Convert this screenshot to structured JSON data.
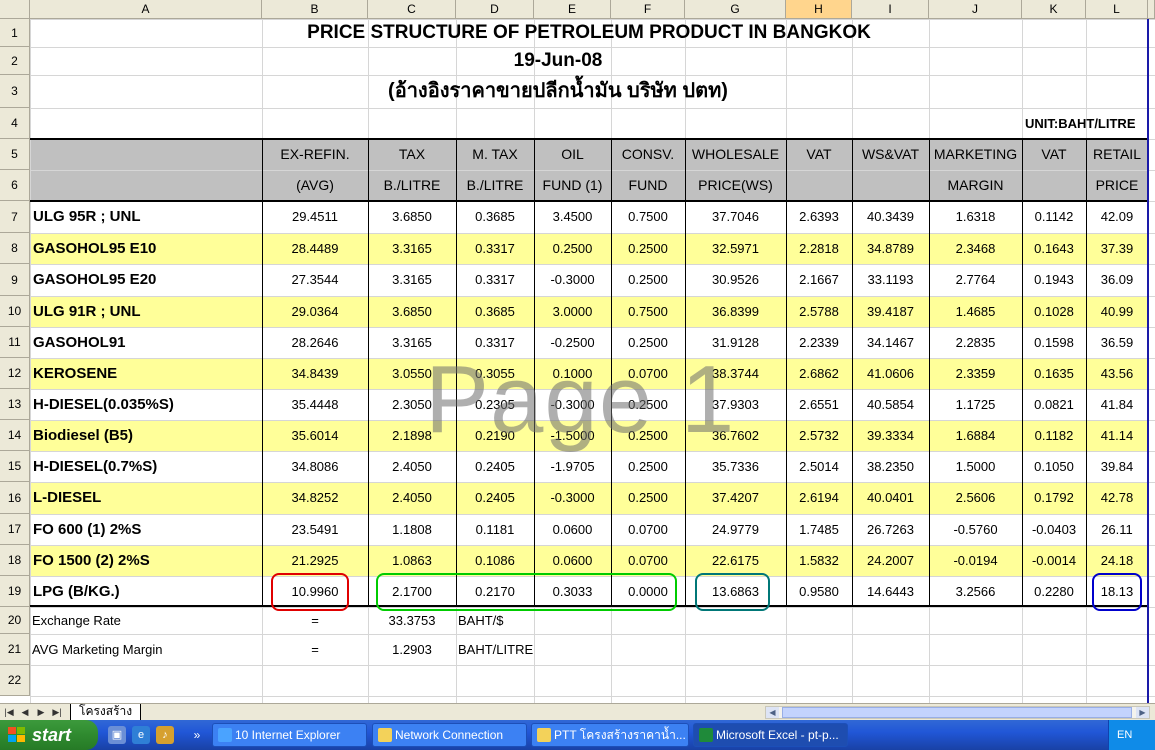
{
  "columns": [
    "A",
    "B",
    "C",
    "D",
    "E",
    "F",
    "G",
    "H",
    "I",
    "J",
    "K",
    "L"
  ],
  "rows": [
    "1",
    "2",
    "3",
    "4",
    "5",
    "6",
    "7",
    "8",
    "9",
    "10",
    "11",
    "12",
    "13",
    "14",
    "15",
    "16",
    "17",
    "18",
    "19",
    "20",
    "21",
    "22"
  ],
  "title": "PRICE STRUCTURE OF PETROLEUM PRODUCT IN BANGKOK",
  "date": "19-Jun-08",
  "reference": "(อ้างอิงราคาขายปลีกน้ำมัน บริษัท ปตท)",
  "unit": "UNIT:BAHT/LITRE",
  "headers": [
    [
      "EX-REFIN.",
      "(AVG)"
    ],
    [
      "TAX",
      "B./LITRE"
    ],
    [
      "M. TAX",
      "B./LITRE"
    ],
    [
      "OIL",
      "FUND (1)"
    ],
    [
      "CONSV.",
      "FUND"
    ],
    [
      "WHOLESALE",
      "PRICE(WS)"
    ],
    [
      "VAT",
      ""
    ],
    [
      "WS&VAT",
      ""
    ],
    [
      "MARKETING",
      "MARGIN"
    ],
    [
      "VAT",
      ""
    ],
    [
      "RETAIL",
      "PRICE"
    ]
  ],
  "products": [
    {
      "name": "ULG 95R ; UNL",
      "values": [
        "29.4511",
        "3.6850",
        "0.3685",
        "3.4500",
        "0.7500",
        "37.7046",
        "2.6393",
        "40.3439",
        "1.6318",
        "0.1142",
        "42.09"
      ]
    },
    {
      "name": "GASOHOL95 E10",
      "values": [
        "28.4489",
        "3.3165",
        "0.3317",
        "0.2500",
        "0.2500",
        "32.5971",
        "2.2818",
        "34.8789",
        "2.3468",
        "0.1643",
        "37.39"
      ]
    },
    {
      "name": "GASOHOL95 E20",
      "values": [
        "27.3544",
        "3.3165",
        "0.3317",
        "-0.3000",
        "0.2500",
        "30.9526",
        "2.1667",
        "33.1193",
        "2.7764",
        "0.1943",
        "36.09"
      ]
    },
    {
      "name": "ULG 91R ; UNL",
      "values": [
        "29.0364",
        "3.6850",
        "0.3685",
        "3.0000",
        "0.7500",
        "36.8399",
        "2.5788",
        "39.4187",
        "1.4685",
        "0.1028",
        "40.99"
      ]
    },
    {
      "name": "GASOHOL91",
      "values": [
        "28.2646",
        "3.3165",
        "0.3317",
        "-0.2500",
        "0.2500",
        "31.9128",
        "2.2339",
        "34.1467",
        "2.2835",
        "0.1598",
        "36.59"
      ]
    },
    {
      "name": "KEROSENE",
      "values": [
        "34.8439",
        "3.0550",
        "0.3055",
        "0.1000",
        "0.0700",
        "38.3744",
        "2.6862",
        "41.0606",
        "2.3359",
        "0.1635",
        "43.56"
      ]
    },
    {
      "name": "H-DIESEL(0.035%S)",
      "values": [
        "35.4448",
        "2.3050",
        "0.2305",
        "-0.3000",
        "0.2500",
        "37.9303",
        "2.6551",
        "40.5854",
        "1.1725",
        "0.0821",
        "41.84"
      ]
    },
    {
      "name": "Biodiesel (B5)",
      "values": [
        "35.6014",
        "2.1898",
        "0.2190",
        "-1.5000",
        "0.2500",
        "36.7602",
        "2.5732",
        "39.3334",
        "1.6884",
        "0.1182",
        "41.14"
      ]
    },
    {
      "name": "H-DIESEL(0.7%S)",
      "values": [
        "34.8086",
        "2.4050",
        "0.2405",
        "-1.9705",
        "0.2500",
        "35.7336",
        "2.5014",
        "38.2350",
        "1.5000",
        "0.1050",
        "39.84"
      ]
    },
    {
      "name": "L-DIESEL",
      "values": [
        "34.8252",
        "2.4050",
        "0.2405",
        "-0.3000",
        "0.2500",
        "37.4207",
        "2.6194",
        "40.0401",
        "2.5606",
        "0.1792",
        "42.78"
      ]
    },
    {
      "name": "FO 600 (1) 2%S",
      "values": [
        "23.5491",
        "1.1808",
        "0.1181",
        "0.0600",
        "0.0700",
        "24.9779",
        "1.7485",
        "26.7263",
        "-0.5760",
        "-0.0403",
        "26.11"
      ]
    },
    {
      "name": "FO 1500 (2) 2%S",
      "values": [
        "21.2925",
        "1.0863",
        "0.1086",
        "0.0600",
        "0.0700",
        "22.6175",
        "1.5832",
        "24.2007",
        "-0.0194",
        "-0.0014",
        "24.18"
      ]
    },
    {
      "name": "LPG (B/KG.)",
      "values": [
        "10.9960",
        "2.1700",
        "0.2170",
        "0.3033",
        "0.0000",
        "13.6863",
        "0.9580",
        "14.6443",
        "3.2566",
        "0.2280",
        "18.13"
      ]
    }
  ],
  "exchange": {
    "label": "Exchange Rate",
    "eq": "=",
    "value": "33.3753",
    "unit": "BAHT/$"
  },
  "margin": {
    "label": "AVG  Marketing Margin",
    "eq": "=",
    "value": "1.2903",
    "unit": "BAHT/LITRE"
  },
  "watermark": "Page 1",
  "sheet_tab": "โครงสร้าง",
  "taskbar": {
    "start": "start",
    "items": [
      {
        "label": "10 Internet Explorer",
        "icon": "ie-icon"
      },
      {
        "label": "Network Connection",
        "icon": "folder-icon"
      },
      {
        "label": "PTT โครงสร้างราคาน้ำ...",
        "icon": "folder-icon"
      },
      {
        "label": "Microsoft Excel - pt-p...",
        "icon": "excel-icon"
      }
    ],
    "lang": "EN"
  },
  "colors": {
    "highlight_red": "#e00000",
    "highlight_green": "#00cc00",
    "highlight_teal": "#007777",
    "highlight_blue": "#0000cc",
    "row_yellow": "#ffff99",
    "header_grey": "#c0c0c0"
  }
}
